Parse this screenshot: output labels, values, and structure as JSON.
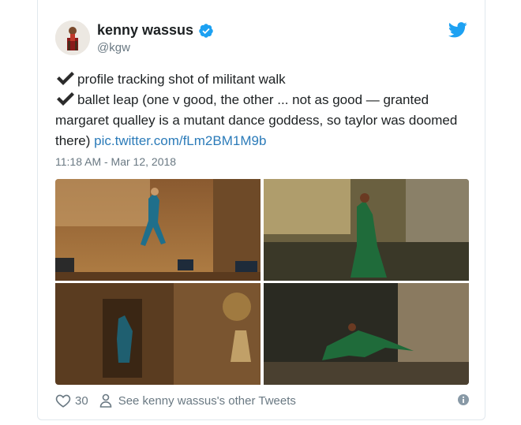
{
  "author": {
    "display_name": "kenny wassus",
    "handle": "@kgw"
  },
  "tweet": {
    "line1": "profile tracking shot of militant walk",
    "line2": "ballet leap (one v good, the other ... not as good — granted margaret qualley is a mutant dance goddess, so taylor was doomed there)",
    "link": "pic.twitter.com/fLm2BM1M9b",
    "timestamp": "11:18 AM - Mar 12, 2018"
  },
  "footer": {
    "like_count": "30",
    "see_more": "See kenny wassus's other Tweets"
  },
  "icons": {
    "verified": "verified-badge-icon",
    "bird": "twitter-bird-icon",
    "check": "check-mark-icon",
    "heart": "heart-icon",
    "person": "person-icon",
    "info": "info-icon"
  },
  "colors": {
    "brand_blue": "#1da1f2",
    "link": "#2b7bb9",
    "secondary_text": "#697882",
    "primary_text": "#1c2022"
  }
}
